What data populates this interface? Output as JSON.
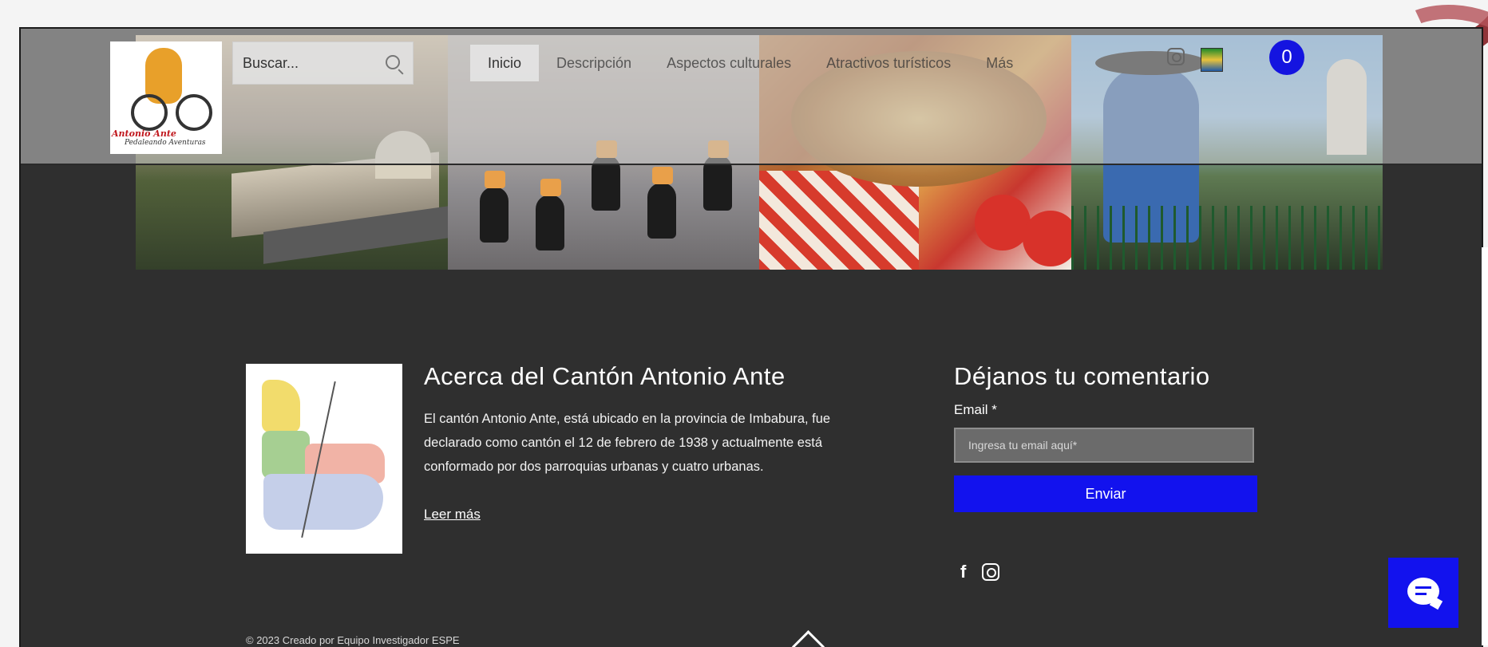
{
  "header": {
    "logo_text_1": "Antonio Ante",
    "logo_text_2": "Pedaleando Aventuras",
    "search_placeholder": "Buscar...",
    "nav": [
      "Inicio",
      "Descripción",
      "Aspectos culturales",
      "Atractivos turísticos",
      "Más"
    ],
    "cart_count": "0"
  },
  "about": {
    "title": "Acerca del Cantón Antonio Ante",
    "text": "El cantón Antonio Ante, está ubicado en la provincia de Imbabura, fue declarado como cantón el 12 de febrero de 1938 y actualmente está conformado por dos parroquias urbanas y cuatro urbanas.",
    "read_more": "Leer más"
  },
  "feedback": {
    "title": "Déjanos tu comentario",
    "email_label": "Email *",
    "email_placeholder": "Ingresa tu email aquí*",
    "send_label": "Enviar"
  },
  "footer": {
    "copyright": "© 2023 Creado por Equipo Investigador ESPE"
  },
  "colors": {
    "accent": "#1212ee",
    "background": "#2f2f2f"
  }
}
